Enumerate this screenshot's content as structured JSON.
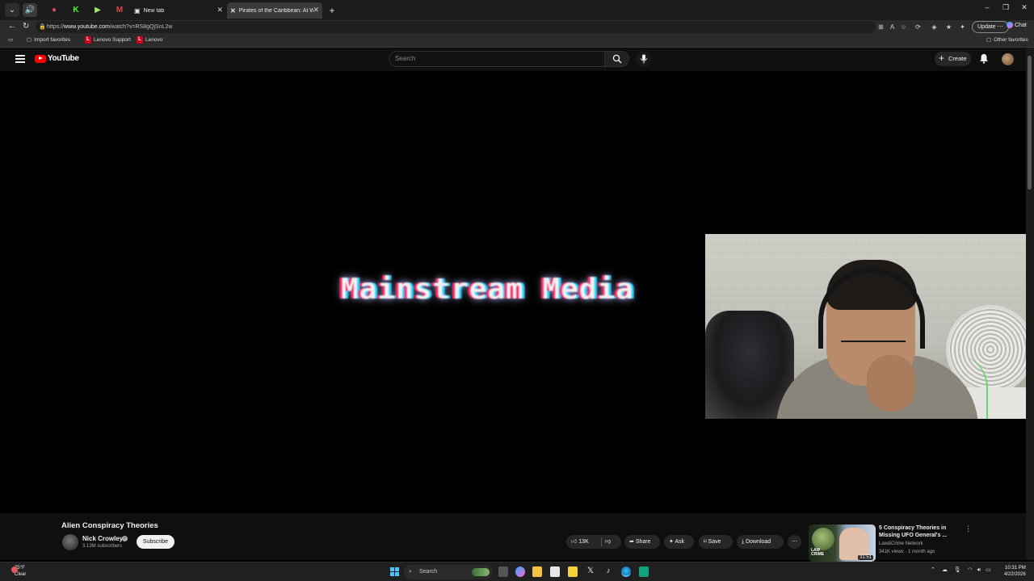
{
  "browser": {
    "tabs": [
      {
        "label": "New tab",
        "active": false
      },
      {
        "label": "Pirates of the Caribbean: At World's End",
        "active": true
      }
    ],
    "new_tab_symbol": "+",
    "window_controls": [
      "–",
      "❐",
      "✕"
    ],
    "url_prefix": "https://",
    "url_host": "www.youtube.com",
    "url_path": "/watch?v=RS8gQjSnL2w",
    "update_label": "Update ⋯",
    "chat_label": "Chat",
    "favorites": [
      "Import favorites",
      "Lenovo Support",
      "Lenovo"
    ],
    "favorite_badge": "L",
    "other_favorites": "Other favorites"
  },
  "youtube": {
    "logo_text": "YouTube",
    "search_placeholder": "Search",
    "create_label": "Create",
    "accent_color": "#ff0000"
  },
  "player": {
    "overlay_text": "Mainstream Media"
  },
  "video": {
    "title": "Alien Conspiracy Theories",
    "channel": "Nick Crowley",
    "subscribers": "3.13M subscribers",
    "subscribe_label": "Subscribe",
    "likes": "13K",
    "share_label": "Share",
    "ask_label": "Ask",
    "save_label": "Save",
    "download_label": "Download"
  },
  "recommendation": {
    "title": "5 Conspiracy Theories in Missing UFO General's ...",
    "channel": "Law&Crime Network",
    "meta": "341K views · 1 month ago",
    "duration": "31:51",
    "thumb_logo_line1": "LAW",
    "thumb_logo_line2": "CRIME"
  },
  "taskbar": {
    "temperature": "75°F",
    "condition": "Clear",
    "search_label": "Search",
    "time": "10:31 PM",
    "date": "4/22/2026"
  }
}
